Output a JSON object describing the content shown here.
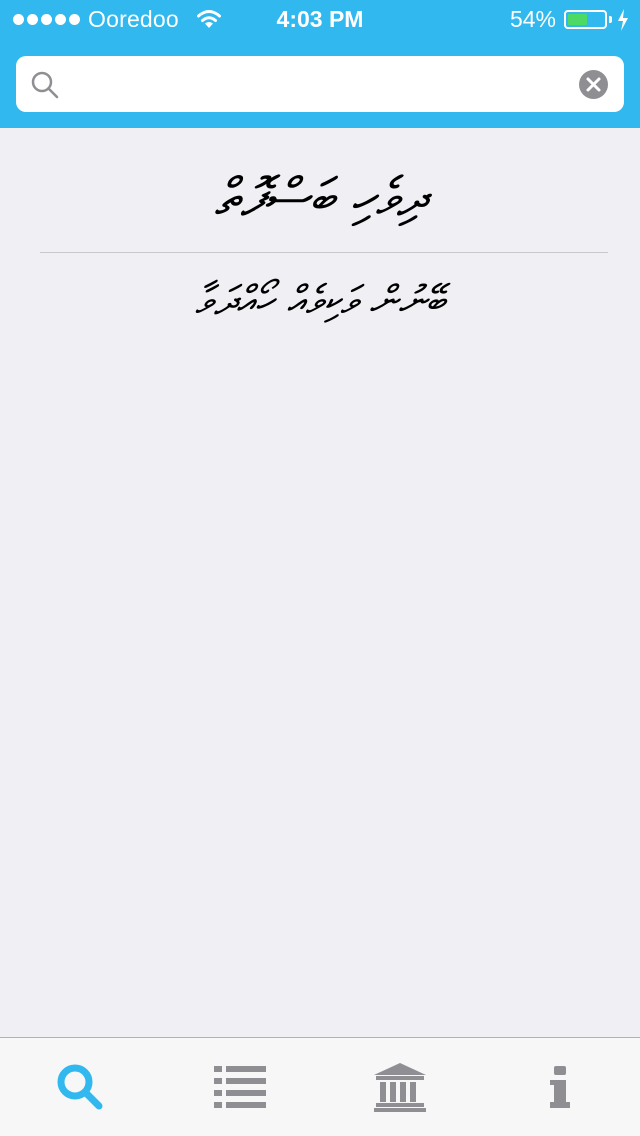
{
  "status_bar": {
    "carrier": "Ooredoo",
    "time": "4:03 PM",
    "battery_percent_text": "54%",
    "battery_level": 0.54,
    "signal_bars": 5
  },
  "search": {
    "placeholder": "",
    "value": ""
  },
  "content": {
    "title": "ދިވެހި ބަސްފޮތް",
    "results": [
      "ބޭނުން ވަކިވެއް ހޯއްދަވާ"
    ]
  },
  "tabs": [
    {
      "icon": "search-icon",
      "selected": true
    },
    {
      "icon": "list-icon",
      "selected": false
    },
    {
      "icon": "institution-icon",
      "selected": false
    },
    {
      "icon": "info-icon",
      "selected": false
    }
  ],
  "colors": {
    "accent": "#30b8ef",
    "background": "#efeff4",
    "battery_green": "#4cd964",
    "tab_inactive": "#8e8e93"
  }
}
